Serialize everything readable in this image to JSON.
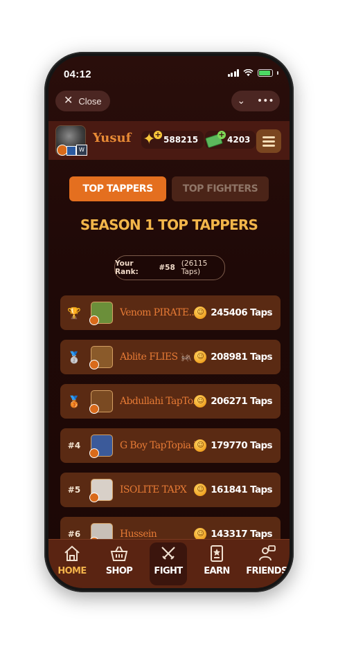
{
  "status": {
    "time": "04:12"
  },
  "topbar": {
    "close_label": "Close",
    "chevron_icon": "chevron-down-icon",
    "more_icon": "more-dots-icon"
  },
  "user": {
    "name": "Yusuf",
    "stars": "588215",
    "cash": "4203"
  },
  "tabs": [
    {
      "label": "TOP TAPPERS",
      "active": true
    },
    {
      "label": "TOP FIGHTERS",
      "active": false
    }
  ],
  "season_title": "SEASON 1 TOP TAPPERS",
  "your_rank": {
    "label": "Your Rank:",
    "value": "#58",
    "taps": "(26115 Taps)"
  },
  "leaderboard": [
    {
      "rank": "🏆",
      "name": "Venom PIRATE...",
      "score": "245406 Taps",
      "avatar_color": "#6b8f3a"
    },
    {
      "rank": "🥈",
      "name": "Ablite FLIES 🦗 T...",
      "score": "208981 Taps",
      "avatar_color": "#8a5a2a"
    },
    {
      "rank": "🥉",
      "name": "Abdullahi TapTo...",
      "score": "206271 Taps",
      "avatar_color": "#7a4a22"
    },
    {
      "rank": "#4",
      "name": "G Boy TapTopia.io",
      "score": "179770 Taps",
      "avatar_color": "#3b5a9a"
    },
    {
      "rank": "#5",
      "name": "ISOLITE TAPX",
      "score": "161841 Taps",
      "avatar_color": "#d8d0c8"
    },
    {
      "rank": "#6",
      "name": "Hussein",
      "score": "143317 Taps",
      "avatar_color": "#c8c0b8"
    }
  ],
  "nav": [
    {
      "label": "HOME",
      "icon": "home-icon"
    },
    {
      "label": "SHOP",
      "icon": "basket-icon"
    },
    {
      "label": "FIGHT",
      "icon": "crossed-swords-icon"
    },
    {
      "label": "EARN",
      "icon": "star-card-icon"
    },
    {
      "label": "FRIENDS",
      "icon": "friends-icon"
    }
  ]
}
